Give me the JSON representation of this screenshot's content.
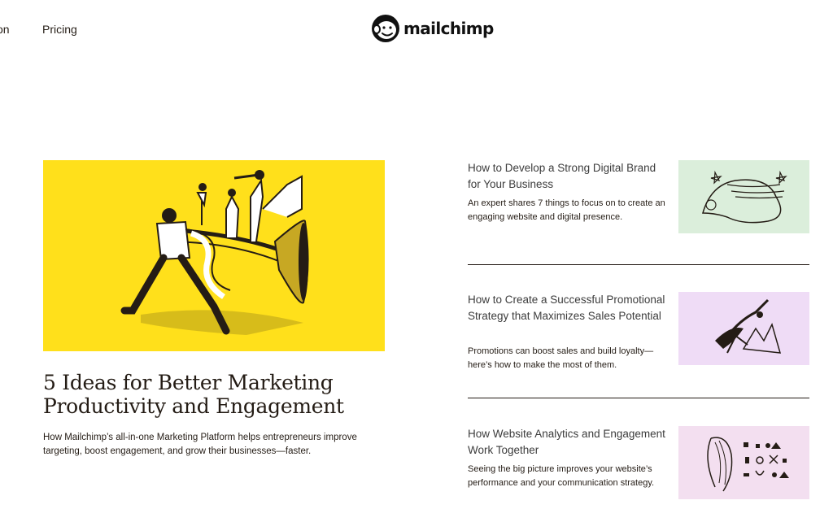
{
  "nav": {
    "partial_link": "on",
    "pricing": "Pricing",
    "logo_text": "mailchimp"
  },
  "hero": {
    "title_line1": "5 Ideas for Better Marketing",
    "title_line2": "Productivity and Engagement",
    "description": "How Mailchimp’s all-in-one Marketing Platform helps entrepreneurs improve targeting, boost engagement, and grow their businesses—faster.",
    "image_color": "#ffe01b",
    "image_icon": "trumpet-illustration-icon"
  },
  "articles": [
    {
      "title": "How to Develop a Strong Digital Brand for Your Business",
      "description": "An expert shares 7 things to focus on to create an engaging website and digital presence.",
      "thumb_color": "#dbeedb",
      "thumb_icon": "reclining-figure-icon"
    },
    {
      "title": "How to Create a Successful Promotional Strategy that Maximizes Sales Potential",
      "description": "Promotions can boost sales and build loyalty—here’s how to make the most of them.",
      "thumb_color": "#efdcf6",
      "thumb_icon": "climbing-figure-icon"
    },
    {
      "title": "How Website Analytics and Engagement Work Together",
      "description": "Seeing the big picture improves your website’s performance and your communication strategy.",
      "thumb_color": "#f3dff0",
      "thumb_icon": "patterns-figure-icon"
    }
  ]
}
